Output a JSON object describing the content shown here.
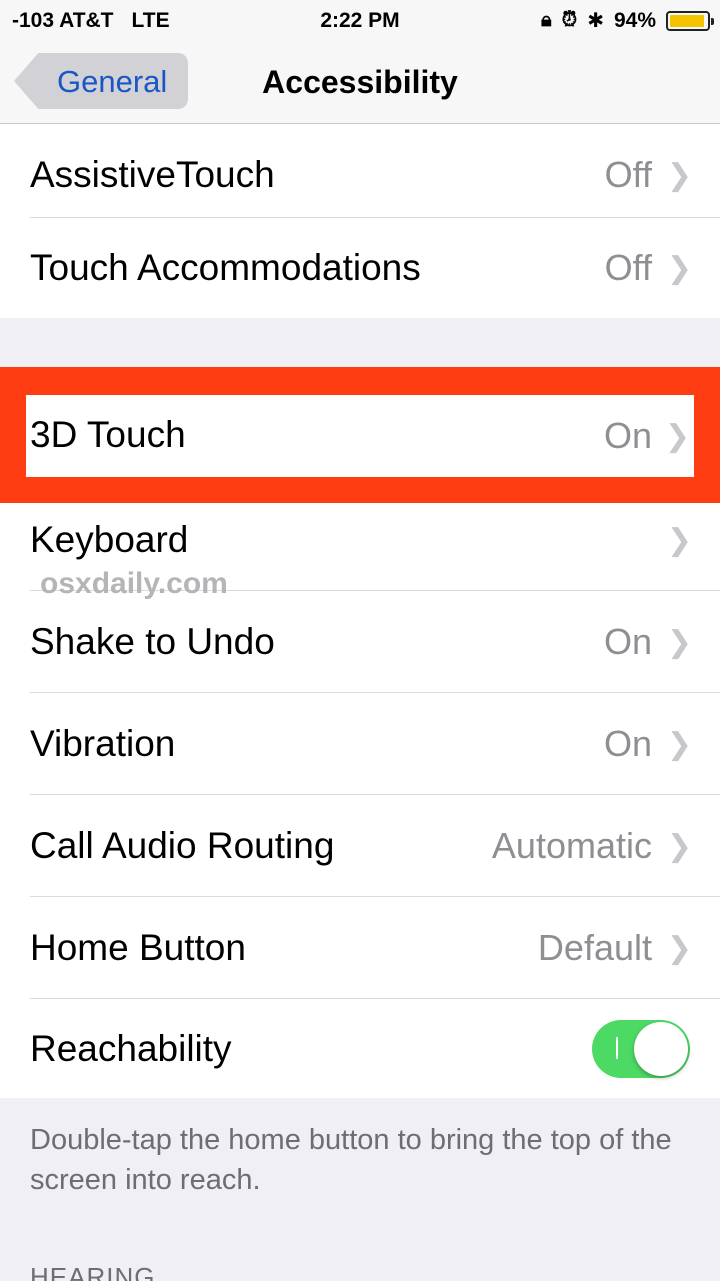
{
  "status": {
    "signal": "-103 AT&T",
    "network": "LTE",
    "time": "2:22 PM",
    "battery": "94%",
    "battery_level": 0.94,
    "icons": [
      "orientation-lock-icon",
      "alarm-icon",
      "bluetooth-icon",
      "battery-icon"
    ]
  },
  "nav": {
    "back_label": "General",
    "title": "Accessibility"
  },
  "rows_top": [
    {
      "label": "AssistiveTouch",
      "value": "Off"
    },
    {
      "label": "Touch Accommodations",
      "value": "Off"
    }
  ],
  "rows_main": [
    {
      "label": "3D Touch",
      "value": "On"
    },
    {
      "label": "Keyboard",
      "value": ""
    },
    {
      "label": "Shake to Undo",
      "value": "On"
    },
    {
      "label": "Vibration",
      "value": "On"
    },
    {
      "label": "Call Audio Routing",
      "value": "Automatic"
    },
    {
      "label": "Home Button",
      "value": "Default"
    }
  ],
  "reachability": {
    "label": "Reachability",
    "enabled": true
  },
  "watermark": "osxdaily.com",
  "footer_note": "Double-tap the home button to bring the top of the screen into reach.",
  "next_section": "HEARING",
  "colors": {
    "highlight": "#ff3d12",
    "toggle_on": "#4cd964",
    "link": "#1a57c6"
  }
}
